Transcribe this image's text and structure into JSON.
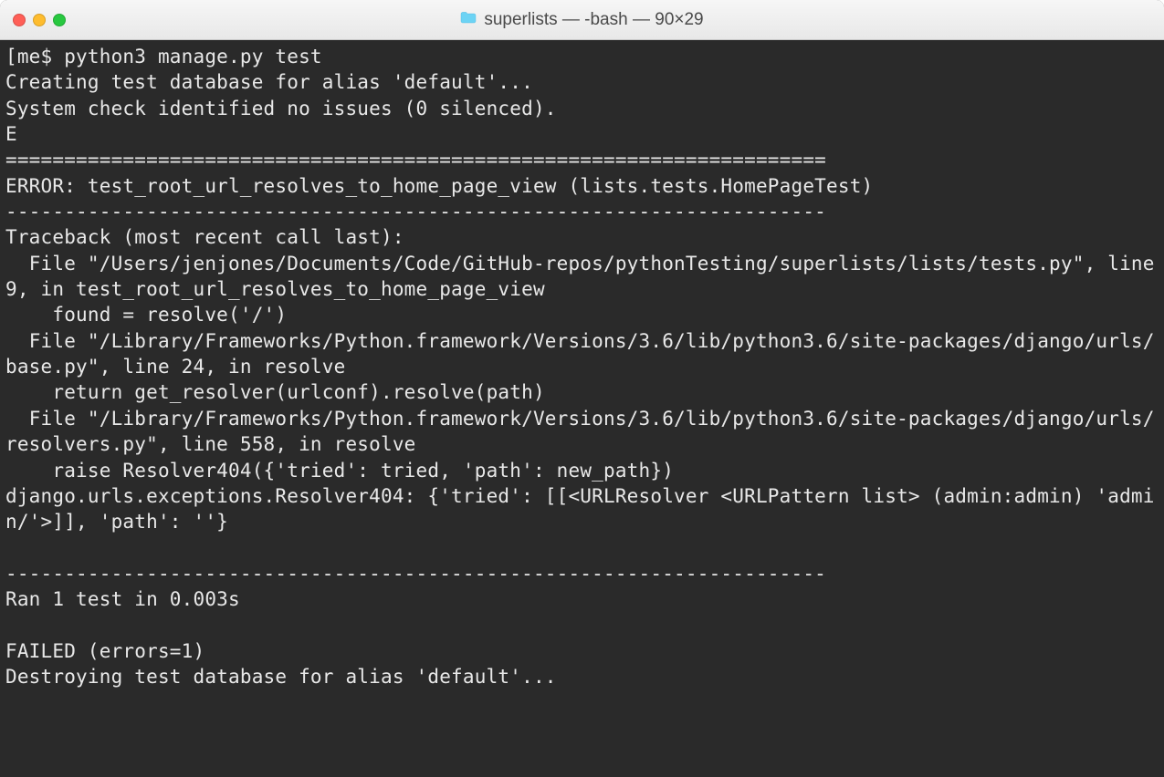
{
  "window": {
    "title": "superlists — -bash — 90×29"
  },
  "terminal": {
    "lines": [
      "[me$ python3 manage.py test",
      "Creating test database for alias 'default'...",
      "System check identified no issues (0 silenced).",
      "E",
      "======================================================================",
      "ERROR: test_root_url_resolves_to_home_page_view (lists.tests.HomePageTest)",
      "----------------------------------------------------------------------",
      "Traceback (most recent call last):",
      "  File \"/Users/jenjones/Documents/Code/GitHub-repos/pythonTesting/superlists/lists/tests.py\", line 9, in test_root_url_resolves_to_home_page_view",
      "    found = resolve('/')",
      "  File \"/Library/Frameworks/Python.framework/Versions/3.6/lib/python3.6/site-packages/django/urls/base.py\", line 24, in resolve",
      "    return get_resolver(urlconf).resolve(path)",
      "  File \"/Library/Frameworks/Python.framework/Versions/3.6/lib/python3.6/site-packages/django/urls/resolvers.py\", line 558, in resolve",
      "    raise Resolver404({'tried': tried, 'path': new_path})",
      "django.urls.exceptions.Resolver404: {'tried': [[<URLResolver <URLPattern list> (admin:admin) 'admin/'>]], 'path': ''}",
      "",
      "----------------------------------------------------------------------",
      "Ran 1 test in 0.003s",
      "",
      "FAILED (errors=1)",
      "Destroying test database for alias 'default'..."
    ]
  }
}
